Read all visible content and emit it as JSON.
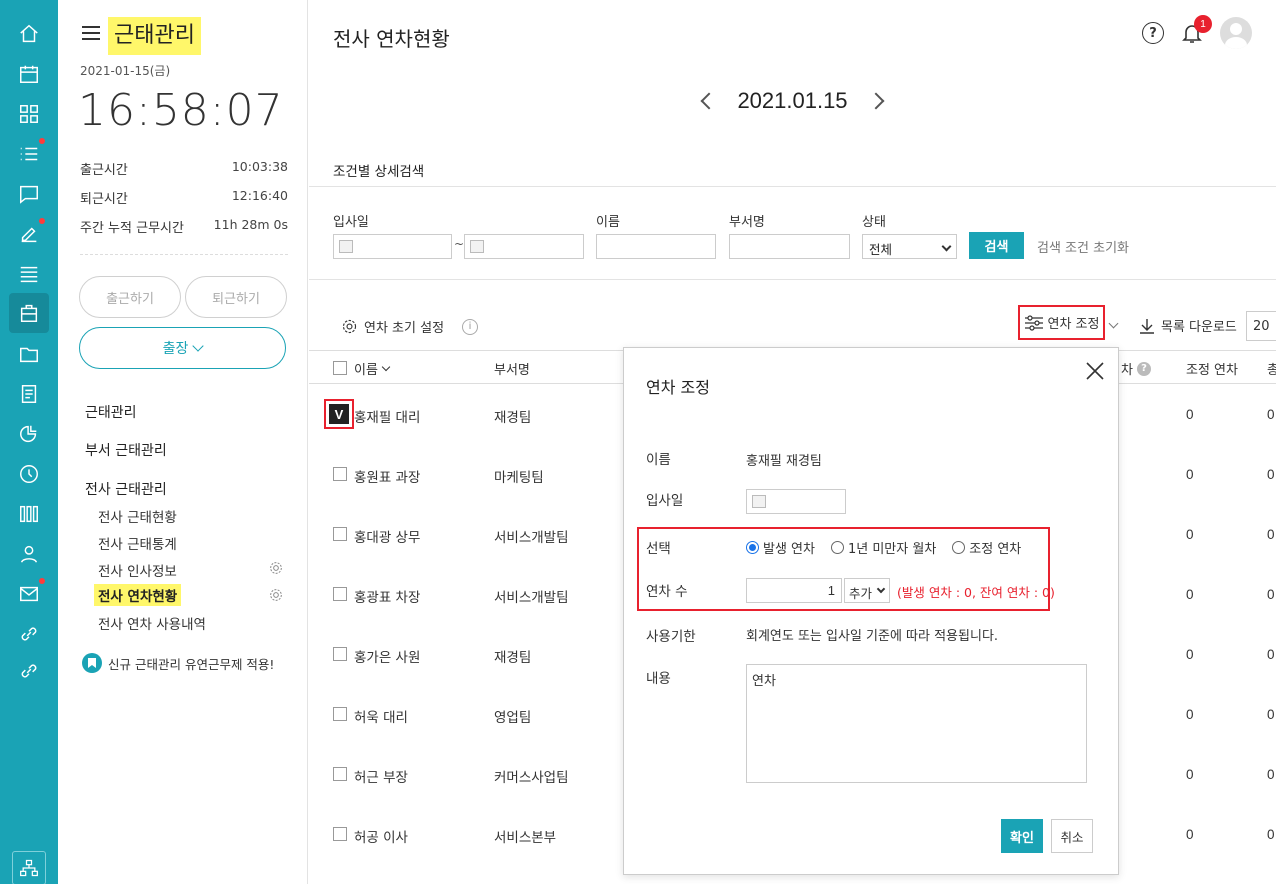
{
  "app": {
    "title": "근태관리",
    "date": "2021-01-15(금)",
    "clock": "16:58:07"
  },
  "times": [
    {
      "label": "출근시간",
      "value": "10:03:38"
    },
    {
      "label": "퇴근시간",
      "value": "12:16:40"
    },
    {
      "label": "주간 누적 근무시간",
      "value": "11h 28m 0s"
    }
  ],
  "buttons": {
    "clock_in": "출근하기",
    "clock_out": "퇴근하기",
    "business_trip": "출장"
  },
  "nav": {
    "heads": [
      "근태관리",
      "부서 근태관리",
      "전사 근태관리"
    ],
    "subs": [
      "전사 근태현황",
      "전사 근태통계",
      "전사 인사정보",
      "전사 연차현황",
      "전사 연차 사용내역"
    ],
    "notice": "신규 근태관리 유연근무제 적용!"
  },
  "header": {
    "page_title": "전사 연차현황",
    "notif_count": "1",
    "help": "?"
  },
  "datenav": {
    "date": "2021.01.15"
  },
  "search": {
    "title": "조건별 상세검색",
    "labels": {
      "join_date": "입사일",
      "name": "이름",
      "dept": "부서명",
      "status": "상태"
    },
    "range_sep": "~",
    "status_value": "전체",
    "search_button": "검색",
    "reset": "검색 조건 초기화"
  },
  "toolbar": {
    "init_settings": "연차 초기 설정",
    "adjust": "연차 조정",
    "download": "목록 다운로드",
    "page_size": "20"
  },
  "table": {
    "headers": {
      "name": "이름",
      "dept": "부서명",
      "col_partial": "차",
      "adjusted": "조정 연차",
      "col_total_partial": "총"
    },
    "rows": [
      {
        "name": "홍재필 대리",
        "dept": "재경팀",
        "adjusted": "0",
        "total": "0"
      },
      {
        "name": "홍원표 과장",
        "dept": "마케팅팀",
        "adjusted": "0",
        "total": "0"
      },
      {
        "name": "홍대광 상무",
        "dept": "서비스개발팀",
        "adjusted": "0",
        "total": "0"
      },
      {
        "name": "홍광표 차장",
        "dept": "서비스개발팀",
        "adjusted": "0",
        "total": "0"
      },
      {
        "name": "홍가은 사원",
        "dept": "재경팀",
        "adjusted": "0",
        "total": "0"
      },
      {
        "name": "허욱 대리",
        "dept": "영업팀",
        "adjusted": "0",
        "total": "0"
      },
      {
        "name": "허근 부장",
        "dept": "커머스사업팀",
        "adjusted": "0",
        "total": "0"
      },
      {
        "name": "허공 이사",
        "dept": "서비스본부",
        "adjusted": "0",
        "total": "0"
      }
    ],
    "checked_mark": "V"
  },
  "modal": {
    "title": "연차 조정",
    "labels": {
      "name": "이름",
      "join_date": "입사일",
      "select": "선택",
      "count": "연차 수",
      "expiry": "사용기한",
      "content": "내용"
    },
    "name_value": "홍재필 재경팀",
    "radios": [
      "발생 연차",
      "1년 미만자 월차",
      "조정 연차"
    ],
    "count_value": "1",
    "add_option": "추가",
    "warning": "(발생 연차 : 0, 잔여 연차 : 0)",
    "expiry_text": "회계연도 또는 입사일 기준에 따라 적용됩니다.",
    "memo": "연차",
    "ok": "확인",
    "cancel": "취소"
  }
}
